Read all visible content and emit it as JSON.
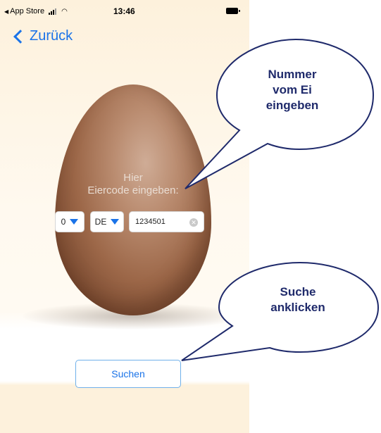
{
  "status_bar": {
    "back_app": "App Store",
    "time": "13:46"
  },
  "nav": {
    "back_label": "Zurück"
  },
  "egg": {
    "hint_line1": "Hier",
    "hint_line2": "Eiercode eingeben:"
  },
  "form": {
    "production_type": "0",
    "country": "DE",
    "code_value": "1234501"
  },
  "search_button": "Suchen",
  "callouts": {
    "enter_number": [
      "Nummer",
      "vom Ei",
      "eingeben"
    ],
    "click_search": [
      "Suche",
      "anklicken"
    ]
  },
  "colors": {
    "accent": "#1a73e8",
    "callout_text": "#1f2a6b",
    "background": "#fdf1dc",
    "egg": "#9c6748"
  }
}
